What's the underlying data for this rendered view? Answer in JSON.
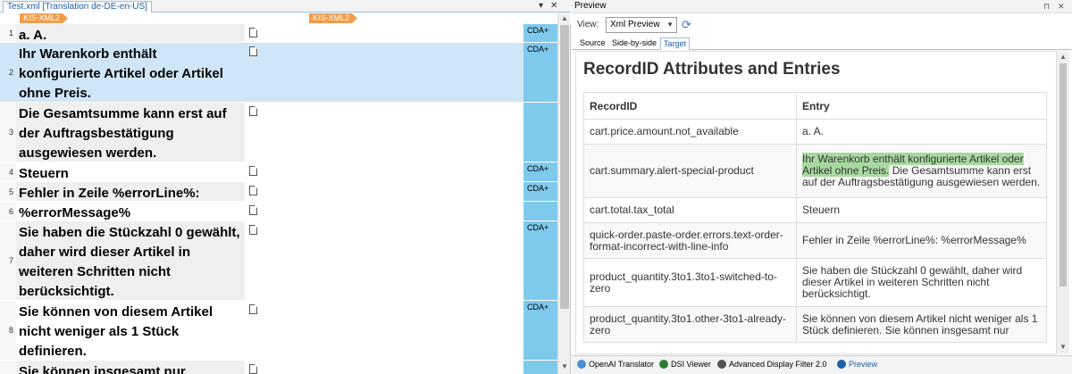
{
  "editor": {
    "tab_label": "Test.xml [Translation de-DE-en-US]",
    "dropdown_glyph": "▾",
    "close_glyph": "✕",
    "source_tag": "KIS-XML2",
    "target_tag": "KIS-XML2",
    "rows": [
      {
        "num": "1",
        "text": "a. A.",
        "cda": "CDA+",
        "shade": true
      },
      {
        "num": "2",
        "text": "Ihr Warenkorb enthält konfigurierte Artikel oder Artikel ohne Preis.",
        "cda": "CDA+",
        "selected": true
      },
      {
        "num": "3",
        "text": "Die Gesamtsumme kann erst auf der Auftragsbestätigung ausgewiesen werden.",
        "cda": "",
        "shade": true
      },
      {
        "num": "4",
        "text": "Steuern",
        "cda": "CDA+"
      },
      {
        "num": "5",
        "text": "Fehler in Zeile %errorLine%:",
        "cda": "CDA+",
        "shade": true
      },
      {
        "num": "6",
        "text": "%errorMessage%",
        "cda": ""
      },
      {
        "num": "7",
        "text": "Sie haben die Stückzahl 0 gewählt, daher wird dieser Artikel in weiteren Schritten nicht berücksichtigt.",
        "cda": "CDA+",
        "shade": true
      },
      {
        "num": "8",
        "text": "Sie können von diesem Artikel nicht weniger als 1 Stück definieren.",
        "cda": "CDA+"
      },
      {
        "num": "",
        "text": "Sie können insgesamt nur",
        "cda": "",
        "shade": true
      }
    ]
  },
  "preview": {
    "panel_title": "Preview",
    "pin_glyph": "⊓",
    "close_glyph": "✕",
    "view_label": "View:",
    "view_value": "Xml Preview",
    "tabs": [
      "Source",
      "Side-by-side",
      "Target"
    ],
    "active_tab": "Target",
    "heading": "RecordID Attributes and Entries",
    "col_recordid": "RecordID",
    "col_entry": "Entry",
    "records": [
      {
        "id": "cart.price.amount.not_available",
        "entry": "a. A."
      },
      {
        "id": "cart.summary.alert-special-product",
        "entry_hl": "Ihr Warenkorb enthält konfigurierte Artikel oder Artikel ohne Preis.",
        "entry_rest": " Die Gesamtsumme kann erst auf der Auftragsbestätigung ausgewiesen werden."
      },
      {
        "id": "cart.total.tax_total",
        "entry": "Steuern"
      },
      {
        "id": "quick-order.paste-order.errors.text-order-format-incorrect-with-line-info",
        "entry": "Fehler in Zeile %errorLine%: %errorMessage%"
      },
      {
        "id": "product_quantity.3to1.3to1-switched-to-zero",
        "entry": "Sie haben die Stückzahl 0 gewählt, daher wird dieser Artikel in weiteren Schritten nicht berücksichtigt."
      },
      {
        "id": "product_quantity.3to1.other-3to1-already-zero",
        "entry": "Sie können von diesem Artikel nicht weniger als 1 Stück definieren. Sie können insgesamt nur"
      }
    ]
  },
  "bottom_tabs": [
    {
      "label": "OpenAI Translator",
      "icon": "openai-icon",
      "color": "#4a8fd0"
    },
    {
      "label": "DSI Viewer",
      "icon": "dsi-viewer-icon",
      "color": "#2e7d32"
    },
    {
      "label": "Advanced Display Filter 2.0",
      "icon": "filter-icon",
      "color": "#555555"
    },
    {
      "label": "Preview",
      "icon": "preview-eye-icon",
      "color": "#1c5fa8",
      "active": true
    }
  ]
}
